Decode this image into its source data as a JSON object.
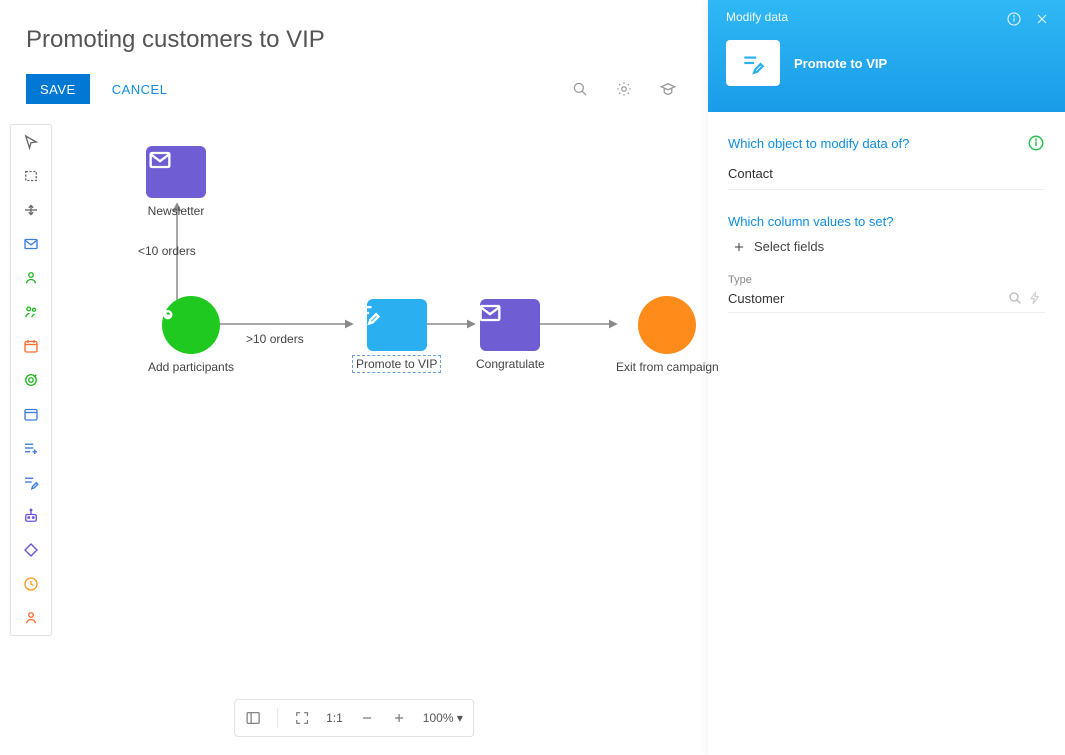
{
  "title": "Promoting customers to VIP",
  "save_label": "SAVE",
  "cancel_label": "CANCEL",
  "edges": {
    "lt10": "<10 orders",
    "gt10": ">10 orders"
  },
  "nodes": {
    "newsletter": "Newsletter",
    "add_participants": "Add participants",
    "promote": "Promote to VIP",
    "congratulate": "Congratulate",
    "exit": "Exit from campaign"
  },
  "zoom": {
    "ratio_label": "1:1",
    "percent_label": "100%"
  },
  "panel": {
    "header_pre": "Modify data",
    "header_name": "Promote to VIP",
    "q_object": "Which object to modify data of?",
    "object_value": "Contact",
    "q_columns": "Which column values to set?",
    "select_fields_label": "Select fields",
    "field_type_label": "Type",
    "field_type_value": "Customer"
  }
}
